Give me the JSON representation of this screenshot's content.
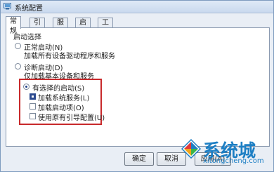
{
  "window": {
    "title": "系统配置"
  },
  "tabs": [
    "常规",
    "引导",
    "服务",
    "启动",
    "工具"
  ],
  "startup_group": {
    "title": "启动选择",
    "options": [
      {
        "label": "正常启动(N)",
        "description": "加载所有设备驱动程序和服务",
        "selected": false
      },
      {
        "label": "诊断启动(D)",
        "description": "仅加载基本设备和服务",
        "selected": false
      },
      {
        "label": "有选择的启动(S)",
        "description": "",
        "selected": true
      }
    ],
    "selective_items": [
      {
        "label": "加载系统服务(L)",
        "checked": true
      },
      {
        "label": "加载启动项(O)",
        "checked": false
      },
      {
        "label": "使用原有引导配置(U)",
        "checked": false
      }
    ]
  },
  "buttons": {
    "ok": "确定",
    "cancel": "取消",
    "apply": "应用(A)"
  },
  "watermark": {
    "brand": "系统城",
    "site": "xitongcheng.com"
  },
  "colors": {
    "highlight": "#c8292b",
    "accent": "#1d7fc4"
  }
}
